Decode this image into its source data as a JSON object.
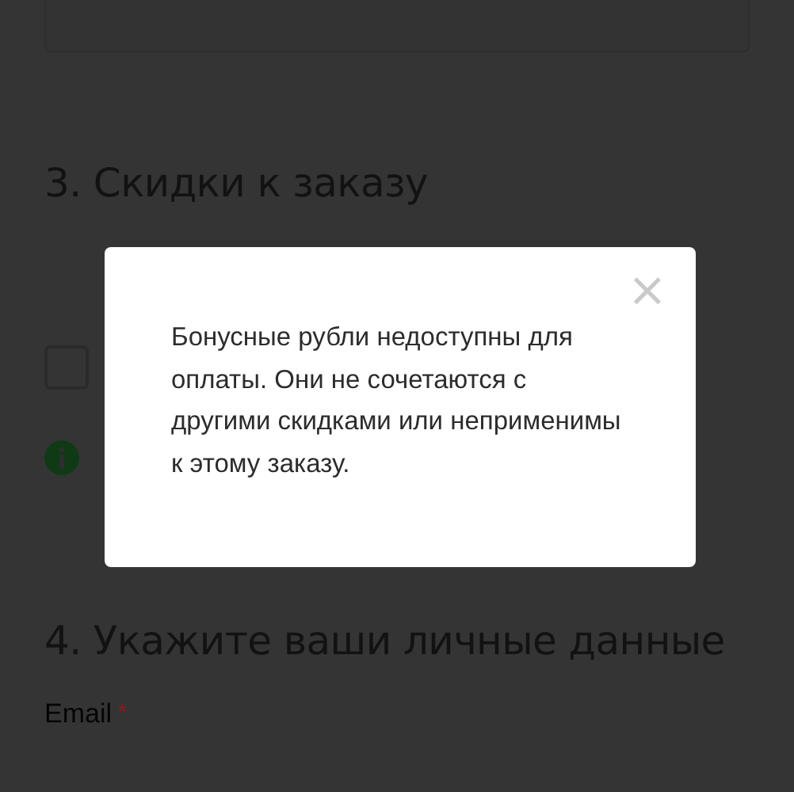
{
  "sections": [
    {
      "number": "3.",
      "title": "Скидки к заказу"
    },
    {
      "number": "4.",
      "title": "Укажите ваши личные данные"
    }
  ],
  "discount_checkbox": {
    "checked": false
  },
  "email_field": {
    "label": "Email",
    "required_mark": "*"
  },
  "dialog": {
    "message": "Бонусные рубли недоступны для оплаты. Они не сочетаются с другими скидками или неприменимы к этому заказу.",
    "close": "×"
  }
}
